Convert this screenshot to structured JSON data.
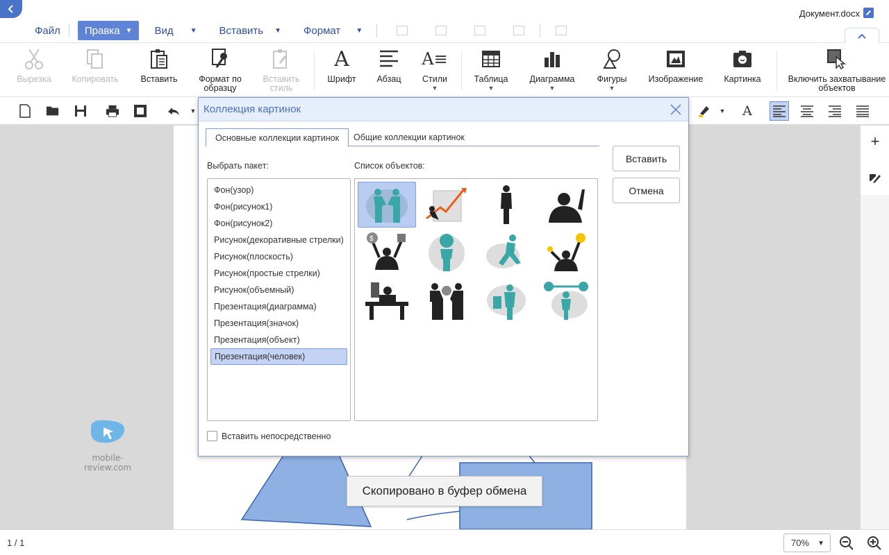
{
  "window": {
    "doc_title": "Документ.docx"
  },
  "menu": {
    "items": [
      {
        "label": "Файл"
      },
      {
        "label": "Правка"
      },
      {
        "label": "Вид"
      },
      {
        "label": "Вставить"
      },
      {
        "label": "Формат"
      }
    ]
  },
  "ribbon": {
    "cut": "Вырезка",
    "copy": "Копировать",
    "paste": "Вставить",
    "format_painter": "Формат по образцу",
    "paste_style": "Вставить стиль",
    "font": "Шрифт",
    "paragraph": "Абзац",
    "styles": "Стили",
    "table": "Таблица",
    "chart": "Диаграмма",
    "shapes": "Фигуры",
    "image": "Изображение",
    "picture": "Картинка",
    "capture": "Включить захватывание объектов"
  },
  "dialog": {
    "title": "Коллекция картинок",
    "tabs": [
      "Основные коллекции картинок",
      "Общие коллекции картинок"
    ],
    "package_label": "Выбрать пакет:",
    "objects_label": "Список объектов:",
    "packages": [
      "Фон(узор)",
      "Фон(рисунок1)",
      "Фон(рисунок2)",
      "Рисунок(декоративные стрелки)",
      "Рисунок(плоскость)",
      "Рисунок(простые стрелки)",
      "Рисунок(объемный)",
      "Презентация(диаграмма)",
      "Презентация(значок)",
      "Презентация(объект)",
      "Презентация(человек)"
    ],
    "selected_package": "Презентация(человек)",
    "insert_button": "Вставить",
    "cancel_button": "Отмена",
    "direct_insert_label": "Вставить непосредственно"
  },
  "toast": {
    "message": "Скопировано в буфер обмена"
  },
  "watermark": {
    "text": "mobile-review.com"
  },
  "status": {
    "page": "1 / 1",
    "zoom": "70%"
  },
  "colors": {
    "accent": "#5f84d6",
    "menu_text": "#2e4fa3",
    "teal": "#3aa6a6",
    "shape_fill": "#8eb0e3"
  }
}
